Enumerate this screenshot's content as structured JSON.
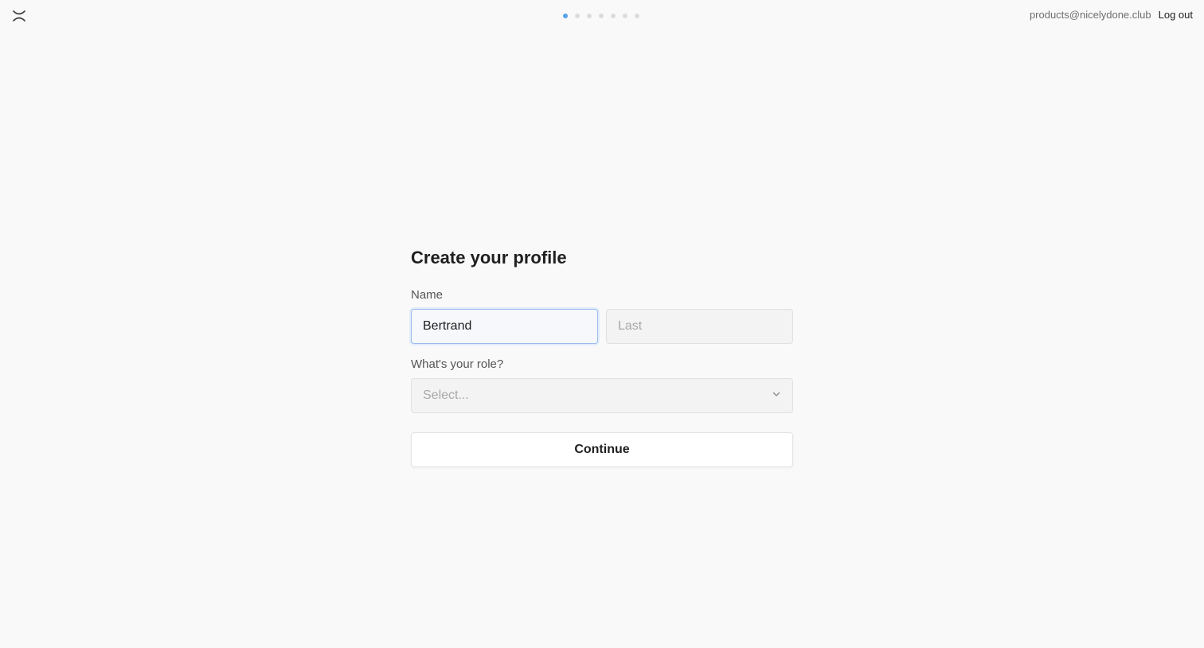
{
  "header": {
    "logo_icon": "linear-logo-icon",
    "steps": {
      "total": 7,
      "current": 1
    },
    "account_email": "products@nicelydone.club",
    "logout_label": "Log out"
  },
  "form": {
    "title": "Create your profile",
    "name_label": "Name",
    "first_name_value": "Bertrand",
    "last_name_placeholder": "Last",
    "role_label": "What's your role?",
    "role_placeholder": "Select...",
    "role_icon": "chevron-down-icon",
    "continue_label": "Continue"
  },
  "colors": {
    "background": "#f9f9f9",
    "accent": "#5aa2e6",
    "focus_border": "#9bbcea"
  }
}
